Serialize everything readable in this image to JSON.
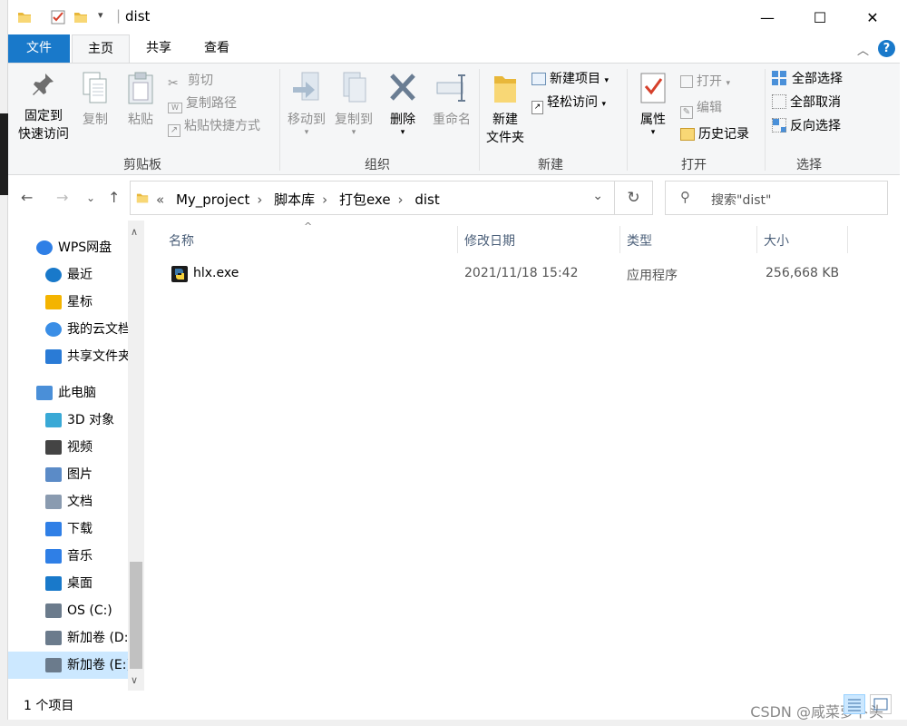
{
  "window": {
    "title": "dist",
    "minimize": "—",
    "maximize": "☐",
    "close": "✕"
  },
  "tabs": {
    "file": "文件",
    "home": "主页",
    "share": "共享",
    "view": "查看",
    "help": "?"
  },
  "ribbon": {
    "clipboard": {
      "group": "剪贴板",
      "pin_line1": "固定到",
      "pin_line2": "快速访问",
      "copy": "复制",
      "paste": "粘贴",
      "cut": "剪切",
      "copy_path": "复制路径",
      "paste_shortcut": "粘贴快捷方式"
    },
    "organize": {
      "group": "组织",
      "move_to": "移动到",
      "copy_to": "复制到",
      "delete": "删除",
      "rename": "重命名"
    },
    "new": {
      "group": "新建",
      "new_folder_line1": "新建",
      "new_folder_line2": "文件夹",
      "new_item": "新建项目",
      "easy_access": "轻松访问"
    },
    "open": {
      "group": "打开",
      "properties": "属性",
      "open": "打开",
      "edit": "编辑",
      "history": "历史记录"
    },
    "select": {
      "group": "选择",
      "select_all": "全部选择",
      "select_none": "全部取消",
      "invert": "反向选择"
    }
  },
  "address": {
    "overflow": "«",
    "crumbs": [
      "My_project",
      "脚本库",
      "打包exe",
      "dist"
    ],
    "search_placeholder": "搜索\"dist\""
  },
  "nav": {
    "items": [
      {
        "label": "WPS网盘",
        "icon": "cloud-icon"
      },
      {
        "label": "最近",
        "icon": "clock-icon"
      },
      {
        "label": "星标",
        "icon": "star-icon"
      },
      {
        "label": "我的云文档",
        "icon": "cloud-doc-icon"
      },
      {
        "label": "共享文件夹",
        "icon": "share-folder-icon"
      },
      {
        "label": "此电脑",
        "icon": "computer-icon"
      },
      {
        "label": "3D 对象",
        "icon": "cube-icon"
      },
      {
        "label": "视频",
        "icon": "video-icon"
      },
      {
        "label": "图片",
        "icon": "picture-icon"
      },
      {
        "label": "文档",
        "icon": "document-icon"
      },
      {
        "label": "下载",
        "icon": "download-icon"
      },
      {
        "label": "音乐",
        "icon": "music-icon"
      },
      {
        "label": "桌面",
        "icon": "desktop-icon"
      },
      {
        "label": "OS (C:)",
        "icon": "drive-icon"
      },
      {
        "label": "新加卷 (D:)",
        "icon": "drive-icon"
      },
      {
        "label": "新加卷 (E:)",
        "icon": "drive-icon"
      }
    ]
  },
  "columns": {
    "name": "名称",
    "date": "修改日期",
    "type": "类型",
    "size": "大小"
  },
  "files": [
    {
      "name": "hlx.exe",
      "date": "2021/11/18 15:42",
      "type": "应用程序",
      "size": "256,668 KB"
    }
  ],
  "status": {
    "count": "1 个项目",
    "watermark": "CSDN @咸菜萝卜头"
  },
  "colors": {
    "accent": "#1979ca",
    "selection": "#cce8ff",
    "ribbon_bg": "#f5f6f7"
  }
}
